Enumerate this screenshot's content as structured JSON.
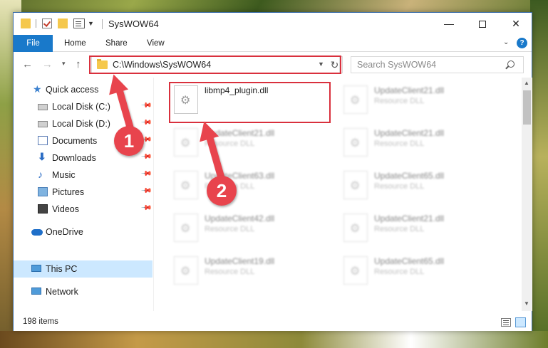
{
  "window": {
    "title": "SysWOW64",
    "minimize_glyph": "—",
    "close_glyph": "✕"
  },
  "ribbon": {
    "tabs": [
      "File",
      "Home",
      "Share",
      "View"
    ]
  },
  "navigation": {
    "back_glyph": "←",
    "forward_glyph": "→",
    "recent_glyph": "▾",
    "up_glyph": "↑"
  },
  "address_bar": {
    "path": "C:\\Windows\\SysWOW64",
    "refresh_glyph": "↻"
  },
  "search": {
    "placeholder": "Search SysWOW64"
  },
  "sidebar": {
    "items": [
      {
        "label": "Quick access",
        "icon": "star-icon",
        "pinned": false
      },
      {
        "label": "Local Disk (C:)",
        "icon": "drive-icon",
        "pinned": true
      },
      {
        "label": "Local Disk (D:)",
        "icon": "drive-icon",
        "pinned": true
      },
      {
        "label": "Documents",
        "icon": "documents-icon",
        "pinned": true
      },
      {
        "label": "Downloads",
        "icon": "download-icon",
        "pinned": true
      },
      {
        "label": "Music",
        "icon": "music-icon",
        "pinned": true
      },
      {
        "label": "Pictures",
        "icon": "pictures-icon",
        "pinned": true
      },
      {
        "label": "Videos",
        "icon": "videos-icon",
        "pinned": true
      },
      {
        "label": "OneDrive",
        "icon": "cloud-icon",
        "pinned": false
      },
      {
        "label": "This PC",
        "icon": "computer-icon",
        "pinned": false,
        "selected": true
      },
      {
        "label": "Network",
        "icon": "network-icon",
        "pinned": false
      }
    ]
  },
  "files": {
    "primary": {
      "name": "libmp4_plugin.dll",
      "type": ""
    },
    "left_column": [
      {
        "name": "UpdateClient21.dll",
        "type": "Resource DLL"
      },
      {
        "name": "UpdateClient63.dll",
        "type": "Resource DLL"
      },
      {
        "name": "UpdateClient42.dll",
        "type": "Resource DLL"
      },
      {
        "name": "UpdateClient19.dll",
        "type": "Resource DLL"
      }
    ],
    "right_column": [
      {
        "name": "UpdateClient21.dll",
        "type": "Resource DLL"
      },
      {
        "name": "UpdateClient21.dll",
        "type": "Resource DLL"
      },
      {
        "name": "UpdateClient65.dll",
        "type": "Resource DLL"
      },
      {
        "name": "UpdateClient21.dll",
        "type": "Resource DLL"
      },
      {
        "name": "UpdateClient65.dll",
        "type": "Resource DLL"
      }
    ]
  },
  "status": {
    "item_count": "198 items"
  },
  "annotations": {
    "step1": "1",
    "step2": "2",
    "color": "#e8444d"
  }
}
